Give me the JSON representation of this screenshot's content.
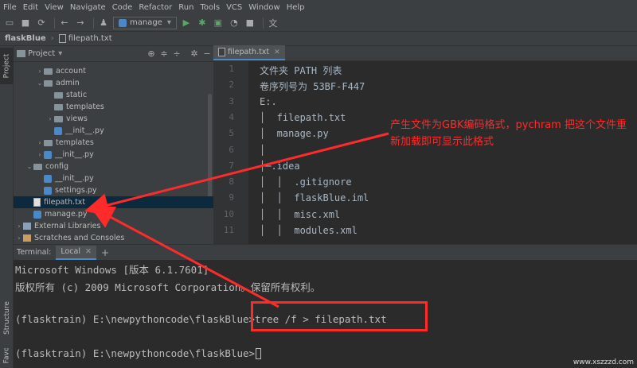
{
  "menu": [
    "File",
    "Edit",
    "View",
    "Navigate",
    "Code",
    "Refactor",
    "Run",
    "Tools",
    "VCS",
    "Window",
    "Help"
  ],
  "toolbar": {
    "run_config": "manage"
  },
  "navbar": {
    "project": "flaskBlue",
    "file": "filepath.txt"
  },
  "sidebar_tabs": {
    "project": "Project",
    "structure": "Structure",
    "favorites": "Favorites"
  },
  "project_panel": {
    "title": "Project"
  },
  "tree": [
    {
      "label": "account",
      "indent": 2,
      "kind": "folder",
      "arrow": "›"
    },
    {
      "label": "admin",
      "indent": 2,
      "kind": "folder",
      "arrow": "⌄"
    },
    {
      "label": "static",
      "indent": 3,
      "kind": "folder",
      "arrow": ""
    },
    {
      "label": "templates",
      "indent": 3,
      "kind": "folder",
      "arrow": ""
    },
    {
      "label": "views",
      "indent": 3,
      "kind": "folder",
      "arrow": "›"
    },
    {
      "label": "__init__.py",
      "indent": 3,
      "kind": "py",
      "arrow": ""
    },
    {
      "label": "templates",
      "indent": 2,
      "kind": "folder",
      "arrow": "›"
    },
    {
      "label": "__init__.py",
      "indent": 2,
      "kind": "py",
      "arrow": "›"
    },
    {
      "label": "config",
      "indent": 1,
      "kind": "folder",
      "arrow": "⌄"
    },
    {
      "label": "__init__.py",
      "indent": 2,
      "kind": "py",
      "arrow": ""
    },
    {
      "label": "settings.py",
      "indent": 2,
      "kind": "py",
      "arrow": ""
    },
    {
      "label": "filepath.txt",
      "indent": 1,
      "kind": "txt",
      "arrow": "",
      "selected": true
    },
    {
      "label": "manage.py",
      "indent": 1,
      "kind": "py",
      "arrow": ""
    },
    {
      "label": "External Libraries",
      "indent": 0,
      "kind": "lib",
      "arrow": "›"
    },
    {
      "label": "Scratches and Consoles",
      "indent": 0,
      "kind": "scratch",
      "arrow": "›"
    }
  ],
  "editor": {
    "tab": "filepath.txt",
    "lines": [
      "文件夹 PATH 列表",
      "卷序列号为 53BF-F447",
      "E:.",
      "│  filepath.txt",
      "│  manage.py",
      "│",
      "├─.idea",
      "│  │  .gitignore",
      "│  │  flaskBlue.iml",
      "│  │  misc.xml",
      "│  │  modules.xml"
    ]
  },
  "annotation": "产生文件为GBK编码格式，pychram 把这个文件重新加载即可显示此格式",
  "terminal": {
    "label": "Terminal:",
    "tab": "Local",
    "lines": [
      "Microsoft Windows [版本 6.1.7601]",
      "版权所有 (c) 2009 Microsoft Corporation。保留所有权利。",
      "",
      "(flasktrain) E:\\newpythoncode\\flaskBlue>tree /f > filepath.txt",
      "",
      "(flasktrain) E:\\newpythoncode\\flaskBlue>"
    ]
  },
  "watermark": "www.xszzzd.com",
  "colors": {
    "annotation": "#ff2b2b",
    "selection": "#0d293e",
    "accent": "#4a88c7"
  }
}
